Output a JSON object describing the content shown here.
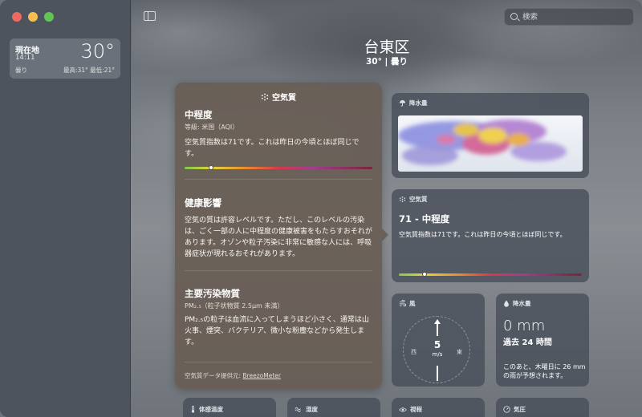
{
  "sidebar": {
    "location": {
      "name": "現在地",
      "time": "14:11",
      "temp": "30°",
      "condition": "曇り",
      "high_low": "最高:31°  最低:21°"
    }
  },
  "search": {
    "placeholder": "検索"
  },
  "header": {
    "city": "台東区",
    "summary": "30°  |  曇り"
  },
  "popover": {
    "title": "空気質",
    "level": {
      "title": "中程度",
      "subtitle": "等級: 米国（AQI）",
      "body": "空気質指数は71です。これは昨日の今頃とほぼ同じです。",
      "indicator_fraction": 0.14
    },
    "health": {
      "title": "健康影響",
      "body": "空気の質は許容レベルです。ただし、このレベルの汚染は、ごく一部の人に中程度の健康被害をもたらすおそれがあります。オゾンや粒子汚染に非常に敏感な人には、呼吸器症状が現れるおそれがあります。"
    },
    "pollutant": {
      "title": "主要汚染物質",
      "subtitle": "PM₂.₅（粒子状物質 2.5μm 未満）",
      "body": "PM₂.₅の粒子は血流に入ってしまうほど小さく、通常は山火事、煙突、バクテリア、微小な粉塵などから発生します。"
    },
    "footer_prefix": "空気質データ提供元: ",
    "footer_link": "BreezoMeter"
  },
  "cards": {
    "precip_map": {
      "label": "降水量"
    },
    "aqi": {
      "label": "空気質",
      "value": "71 - 中程度",
      "desc": "空気質指数は71です。これは昨日の今頃とほぼ同じです。",
      "indicator_fraction": 0.14
    },
    "wind": {
      "label": "風",
      "speed": "5",
      "unit": "m/s",
      "west": "西",
      "east": "東"
    },
    "precip": {
      "label": "降水量",
      "value": "0 mm",
      "period": "過去 24 時間",
      "note": "このあと、木曜日に 26 mmの雨が予想されます。"
    },
    "bottom": {
      "feels_like": "体感温度",
      "humidity": "湿度",
      "visibility": "視程",
      "pressure": "気圧"
    }
  }
}
